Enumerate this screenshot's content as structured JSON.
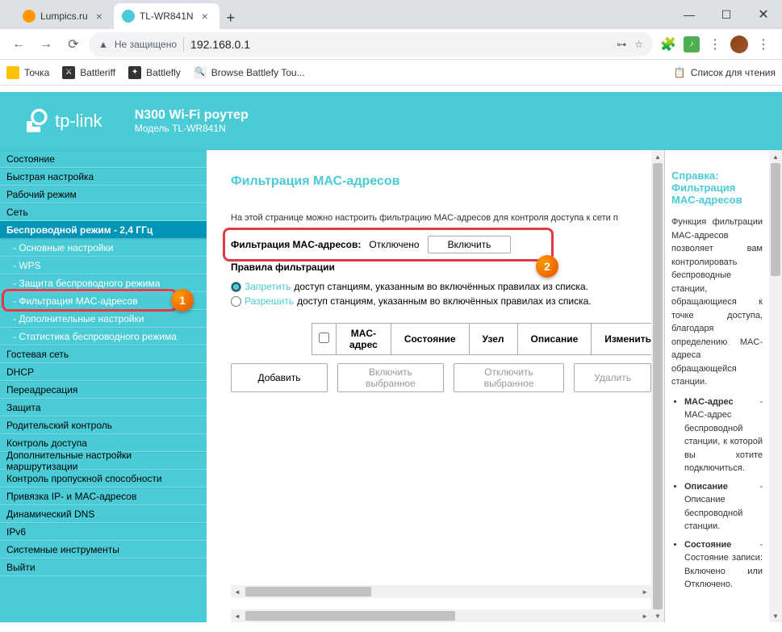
{
  "browser": {
    "tabs": [
      {
        "title": "Lumpics.ru",
        "favicon_color": "#FF9800",
        "active": false
      },
      {
        "title": "TL-WR841N",
        "favicon_color": "#4ACBD6",
        "active": true
      }
    ],
    "address": {
      "warning": "Не защищено",
      "url": "192.168.0.1"
    },
    "bookmarks": [
      {
        "label": "Точка",
        "icon_bg": "#FFC107"
      },
      {
        "label": "Battleriff",
        "icon_bg": "#333"
      },
      {
        "label": "Battlefly",
        "icon_bg": "#333"
      },
      {
        "label": "Browse Battlefy Tou...",
        "icon_bg": "#eee"
      }
    ],
    "reading_list": "Список для чтения"
  },
  "router": {
    "brand": "tp-link",
    "product_title": "N300 Wi-Fi роутер",
    "product_model": "Модель TL-WR841N"
  },
  "sidebar": [
    {
      "label": "Состояние"
    },
    {
      "label": "Быстрая настройка"
    },
    {
      "label": "Рабочий режим"
    },
    {
      "label": "Сеть"
    },
    {
      "label": "Беспроводной режим - 2,4 ГГц",
      "active": true
    },
    {
      "label": "- Основные настройки",
      "sub": true
    },
    {
      "label": "- WPS",
      "sub": true
    },
    {
      "label": "- Защита беспроводного режима",
      "sub": true
    },
    {
      "label": "- Фильтрация MAC-адресов",
      "sub": true,
      "highlighted": true
    },
    {
      "label": "- Дополнительные настройки",
      "sub": true
    },
    {
      "label": "- Статистика беспроводного режима",
      "sub": true
    },
    {
      "label": "Гостевая сеть"
    },
    {
      "label": "DHCP"
    },
    {
      "label": "Переадресация"
    },
    {
      "label": "Защита"
    },
    {
      "label": "Родительский контроль"
    },
    {
      "label": "Контроль доступа"
    },
    {
      "label": "Дополнительные настройки маршрутизации"
    },
    {
      "label": "Контроль пропускной способности"
    },
    {
      "label": "Привязка IP- и MAC-адресов"
    },
    {
      "label": "Динамический DNS"
    },
    {
      "label": "IPv6"
    },
    {
      "label": "Системные инструменты"
    },
    {
      "label": "Выйти"
    }
  ],
  "page": {
    "title": "Фильтрация МАС-адресов",
    "desc": "На этой странице можно настроить фильтрацию MAC-адресов для контроля доступа к сети п",
    "filter_label": "Фильтрация MAC-адресов:",
    "filter_status": "Отключено",
    "enable_btn": "Включить",
    "rules_title": "Правила фильтрации",
    "rule_deny_action": "Запретить",
    "rule_deny_text": " доступ станциям, указанным во включённых правилах из списка.",
    "rule_allow_action": "Разрешить",
    "rule_allow_text": " доступ станциям, указанным во включённых правилах из списка.",
    "table_headers": [
      "MAC-адрес",
      "Состояние",
      "Узел",
      "Описание",
      "Изменить"
    ],
    "buttons": {
      "add": "Добавить",
      "enable_selected": "Включить выбранное",
      "disable_selected": "Отключить выбранное",
      "delete": "Удалить"
    }
  },
  "help": {
    "title": "Справка: Фильтрация MAC-адресов",
    "intro": "Функция фильтрации MAC-адресов позволяет вам контролировать беспроводные станции, обращающиеся к точке доступа, благодаря определению MAC-адреса обращающейся станции.",
    "items": [
      {
        "term": "MAC-адрес",
        "desc": " - MAC-адрес беспроводной станции, к которой вы хотите подключиться."
      },
      {
        "term": "Описание",
        "desc": " - Описание беспроводной станции."
      },
      {
        "term": "Состояние",
        "desc": " - Состояние записи: Включено или Отключено."
      }
    ]
  },
  "annotations": {
    "a1": "1",
    "a2": "2"
  }
}
